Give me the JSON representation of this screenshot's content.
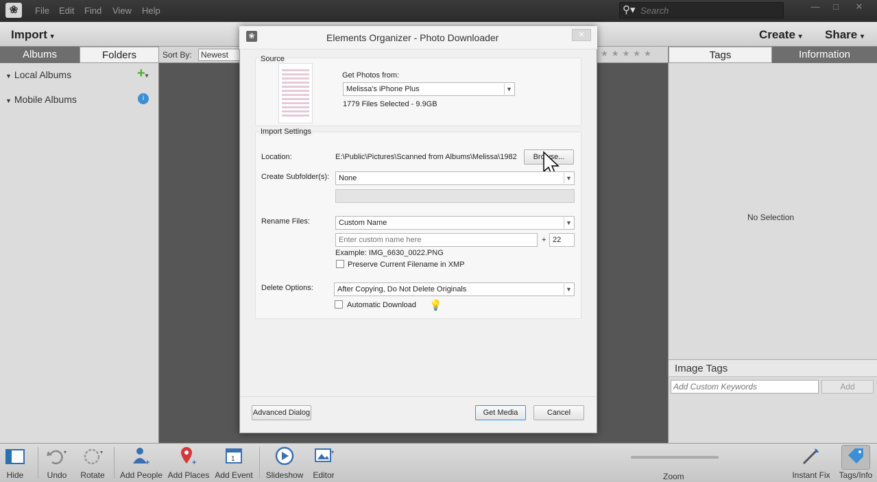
{
  "menu": {
    "file": "File",
    "edit": "Edit",
    "find": "Find",
    "view": "View",
    "help": "Help"
  },
  "search": {
    "placeholder": "Search"
  },
  "topbar": {
    "import": "Import",
    "create": "Create",
    "share": "Share"
  },
  "left": {
    "tab_albums": "Albums",
    "tab_folders": "Folders",
    "local_albums": "Local Albums",
    "mobile_albums": "Mobile Albums"
  },
  "sortbar": {
    "label": "Sort By:",
    "value": "Newest"
  },
  "right": {
    "tab_tags": "Tags",
    "tab_information": "Information",
    "no_selection": "No Selection",
    "image_tags": "Image Tags",
    "keywords_placeholder": "Add Custom Keywords",
    "add": "Add"
  },
  "dialog": {
    "title": "Elements Organizer - Photo Downloader",
    "source_label": "Source",
    "get_photos_label": "Get Photos from:",
    "device": "Melissa's iPhone Plus",
    "files_selected": "1779 Files Selected - 9.9GB",
    "import_settings_label": "Import Settings",
    "location_label": "Location:",
    "location_value": "E:\\Public\\Pictures\\Scanned from Albums\\Melissa\\1982",
    "browse": "Browse...",
    "subfolder_label": "Create Subfolder(s):",
    "subfolder_value": "None",
    "rename_label": "Rename Files:",
    "rename_value": "Custom Name",
    "custom_name_placeholder": "Enter custom name here",
    "plus": "+",
    "number_value": "22",
    "example": "Example:  IMG_6630_0022.PNG",
    "preserve_label": "Preserve Current Filename in XMP",
    "delete_label": "Delete Options:",
    "delete_value": "After Copying, Do Not Delete Originals",
    "auto_download": "Automatic Download",
    "advanced": "Advanced Dialog",
    "get_media": "Get Media",
    "cancel": "Cancel"
  },
  "bottom": {
    "hide": "Hide",
    "undo": "Undo",
    "rotate": "Rotate",
    "add_people": "Add People",
    "add_places": "Add Places",
    "add_event": "Add Event",
    "slideshow": "Slideshow",
    "editor": "Editor",
    "zoom": "Zoom",
    "instant_fix": "Instant Fix",
    "tags_info": "Tags/Info"
  },
  "colors": {
    "accent": "#3a8fd6",
    "panel": "#dcdcdc",
    "dark": "#565656"
  }
}
